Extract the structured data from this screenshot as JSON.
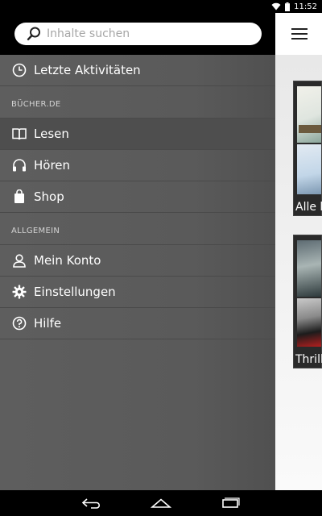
{
  "status_bar": {
    "time": "11:52",
    "icons": [
      "wifi-icon",
      "battery-icon"
    ]
  },
  "search": {
    "placeholder": "Inhalte suchen"
  },
  "drawer": {
    "recent": {
      "label": "Letzte Aktivitäten",
      "icon": "clock-icon"
    },
    "section_books": "BÜCHER.DE",
    "books_items": [
      {
        "label": "Lesen",
        "icon": "book-open-icon"
      },
      {
        "label": "Hören",
        "icon": "headphones-icon"
      },
      {
        "label": "Shop",
        "icon": "shopping-bag-icon"
      }
    ],
    "section_general": "ALLGEMEIN",
    "general_items": [
      {
        "label": "Mein Konto",
        "icon": "person-icon"
      },
      {
        "label": "Einstellungen",
        "icon": "gear-icon"
      },
      {
        "label": "Hilfe",
        "icon": "help-circle-icon"
      }
    ]
  },
  "content": {
    "cards": [
      {
        "label": "Alle l"
      },
      {
        "label": "Thrill"
      }
    ]
  },
  "nav": {
    "icons": [
      "back-icon",
      "home-icon",
      "recents-icon"
    ]
  },
  "colors": {
    "drawer_bg": "#5a5a5a",
    "header_bg": "#000000",
    "content_bg": "#efefef"
  }
}
